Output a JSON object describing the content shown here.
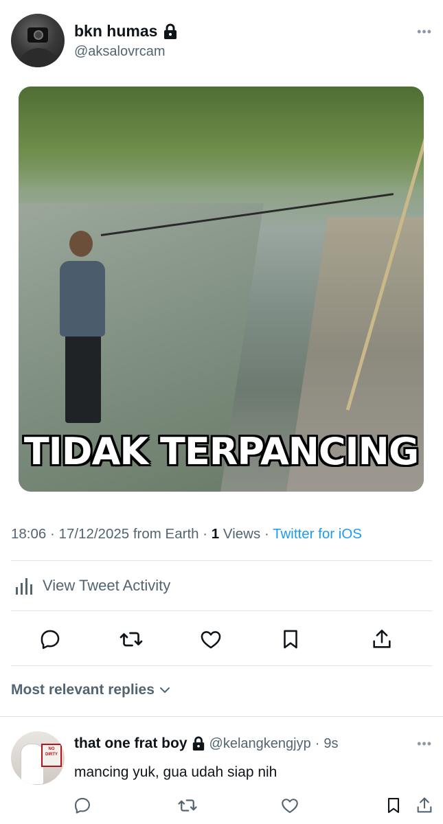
{
  "tweet": {
    "author_name": "bkn humas",
    "author_handle": "@aksalovrcam",
    "more_label": "•••",
    "image_caption": "TIDAK TERPANCING",
    "time": "18:06",
    "date": "17/12/2025",
    "location": "from Earth",
    "views_count": "1",
    "views_label": "Views",
    "source": "Twitter for iOS",
    "separator": "·"
  },
  "activity": {
    "label": "View Tweet Activity"
  },
  "actions": [
    "reply-icon",
    "retweet-icon",
    "like-icon",
    "bookmark-icon",
    "share-icon"
  ],
  "replies_filter": {
    "label": "Most relevant replies"
  },
  "reply": {
    "name": "that one frat boy",
    "handle": "@kelangkengjyp",
    "age": "9s",
    "separator": "·",
    "text": "mancing yuk, gua udah siap nih",
    "more_label": "•••"
  },
  "colors": {
    "link": "#1d9bf0",
    "muted": "#536471",
    "text": "#0f1419"
  }
}
